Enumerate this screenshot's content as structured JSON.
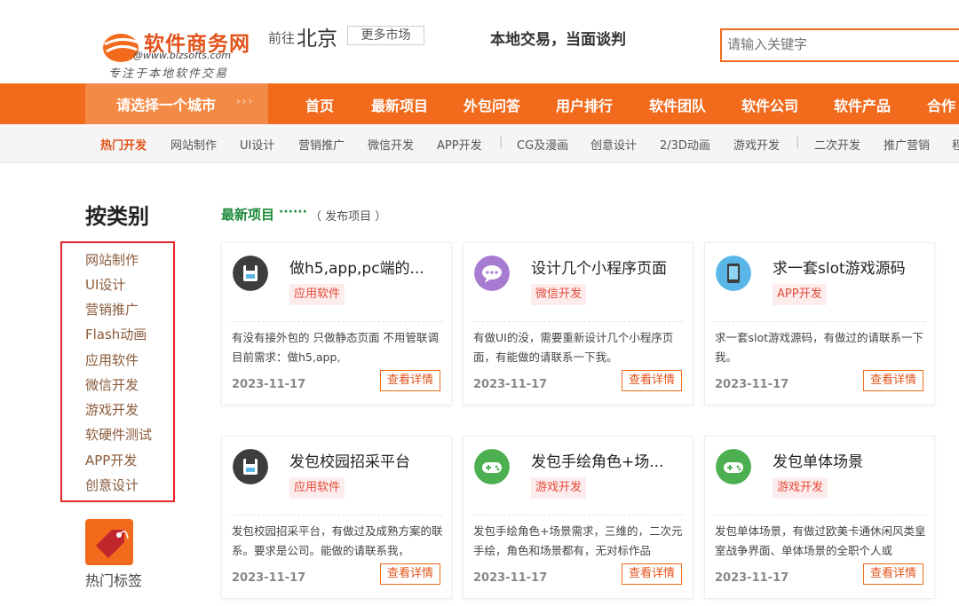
{
  "logo": {
    "name": "软件商务网",
    "url": "@www.bizsofts.com",
    "slogan": "专注于本地软件交易"
  },
  "header": {
    "goto": "前往",
    "city": "北京",
    "more_market": "更多市场",
    "tagline": "本地交易，当面谈判",
    "search_placeholder": "请输入关键字"
  },
  "nav": {
    "city_select": "请选择一个城市",
    "city_select_arrows": "›››",
    "items": [
      "首页",
      "最新项目",
      "外包问答",
      "用户排行",
      "软件团队",
      "软件公司",
      "软件产品",
      "合作"
    ]
  },
  "subnav": {
    "items": [
      "热门开发",
      "网站制作",
      "UI设计",
      "营销推广",
      "微信开发",
      "APP开发",
      "|",
      "CG及漫画",
      "创意设计",
      "2/3D动画",
      "游戏开发",
      "|",
      "二次开发",
      "推广营销",
      "程"
    ]
  },
  "sidebar": {
    "title": "按类别",
    "categories": [
      "网站制作",
      "UI设计",
      "营销推广",
      "Flash动画",
      "应用软件",
      "微信开发",
      "游戏开发",
      "软硬件测试",
      "APP开发",
      "创意设计"
    ],
    "hot_tags": "热门标签"
  },
  "section": {
    "title": "最新项目",
    "dots": "······",
    "publish": "（ 发布项目 ）"
  },
  "cards": [
    {
      "title": "做h5,app,pc端的...",
      "tag": "应用软件",
      "desc": "有没有接外包的 只做静态页面 不用管联调 目前需求：做h5,app,",
      "date": "2023-11-17",
      "btn": "查看详情",
      "icon": "floppy-icon",
      "icon_color": "#3d3d3d"
    },
    {
      "title": "设计几个小程序页面",
      "tag": "微信开发",
      "desc": "有做UI的没，需要重新设计几个小程序页面，有能做的请联系一下我。",
      "date": "2023-11-17",
      "btn": "查看详情",
      "icon": "chat-icon",
      "icon_color": "#a77bd1"
    },
    {
      "title": "求一套slot游戏源码",
      "tag": "APP开发",
      "desc": "求一套slot游戏源码，有做过的请联系一下我。",
      "date": "2023-11-17",
      "btn": "查看详情",
      "icon": "phone-icon",
      "icon_color": "#5ab6e6"
    },
    {
      "title": "发包校园招采平台",
      "tag": "应用软件",
      "desc": "发包校园招采平台，有做过及成熟方案的联系。要求是公司。能做的请联系我，",
      "date": "2023-11-17",
      "btn": "查看详情",
      "icon": "floppy-icon",
      "icon_color": "#3d3d3d"
    },
    {
      "title": "发包手绘角色+场...",
      "tag": "游戏开发",
      "desc": "发包手绘角色+场景需求，三维的，二次元手绘，角色和场景都有，无对标作品",
      "date": "2023-11-17",
      "btn": "查看详情",
      "icon": "gamepad-icon",
      "icon_color": "#4caf50"
    },
    {
      "title": "发包单体场景",
      "tag": "游戏开发",
      "desc": "发包单体场景，有做过欧美卡通休闲风类皇室战争界面、单体场景的全职个人或",
      "date": "2023-11-17",
      "btn": "查看详情",
      "icon": "gamepad-icon",
      "icon_color": "#4caf50"
    }
  ],
  "colors": {
    "brand_orange": "#f26b1d",
    "highlight_red": "#e8262b",
    "section_green": "#1c8a3a"
  }
}
